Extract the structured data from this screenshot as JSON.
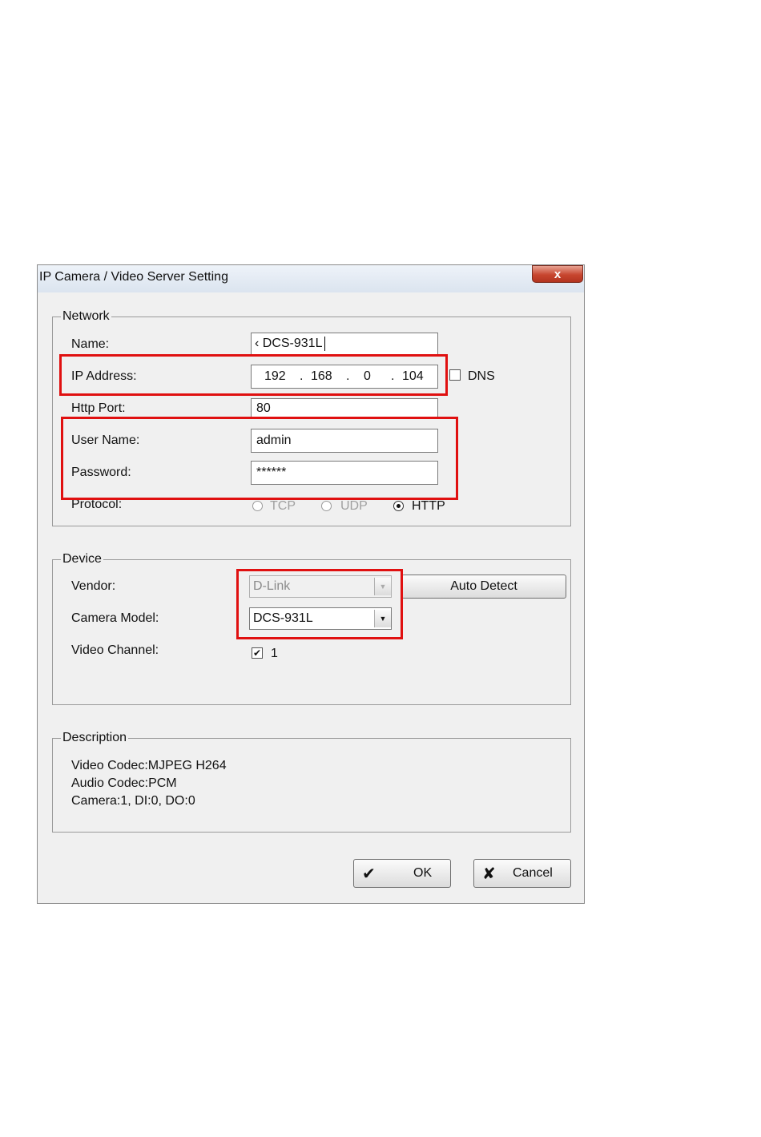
{
  "dialog": {
    "title": "IP Camera / Video Server Setting",
    "close_glyph": "x"
  },
  "network": {
    "legend": "Network",
    "name_label": "Name:",
    "name_value": "‹ DCS-931L",
    "ip_label": "IP Address:",
    "ip_octets": [
      "192",
      "168",
      "0",
      "104"
    ],
    "dns_label": "DNS",
    "port_label": "Http Port:",
    "port_value": "80",
    "user_label": "User Name:",
    "user_value": "admin",
    "password_label": "Password:",
    "password_value": "******",
    "protocol_label": "Protocol:",
    "protocols": [
      "TCP",
      "UDP",
      "HTTP"
    ],
    "selected_protocol": "HTTP"
  },
  "device": {
    "legend": "Device",
    "vendor_label": "Vendor:",
    "vendor_value": "D-Link",
    "auto_detect": "Auto Detect",
    "model_label": "Camera Model:",
    "model_value": "DCS-931L",
    "channel_label": "Video Channel:",
    "channel_value": "1",
    "channel_checked": true
  },
  "description": {
    "legend": "Description",
    "lines": [
      "Video Codec:MJPEG H264",
      "Audio Codec:PCM",
      "Camera:1, DI:0, DO:0"
    ]
  },
  "buttons": {
    "ok": "OK",
    "cancel": "Cancel",
    "ok_glyph": "✔",
    "cancel_glyph": "✘"
  },
  "colors": {
    "highlight": "#e01010",
    "dialog_bg": "#f0f0f0"
  }
}
